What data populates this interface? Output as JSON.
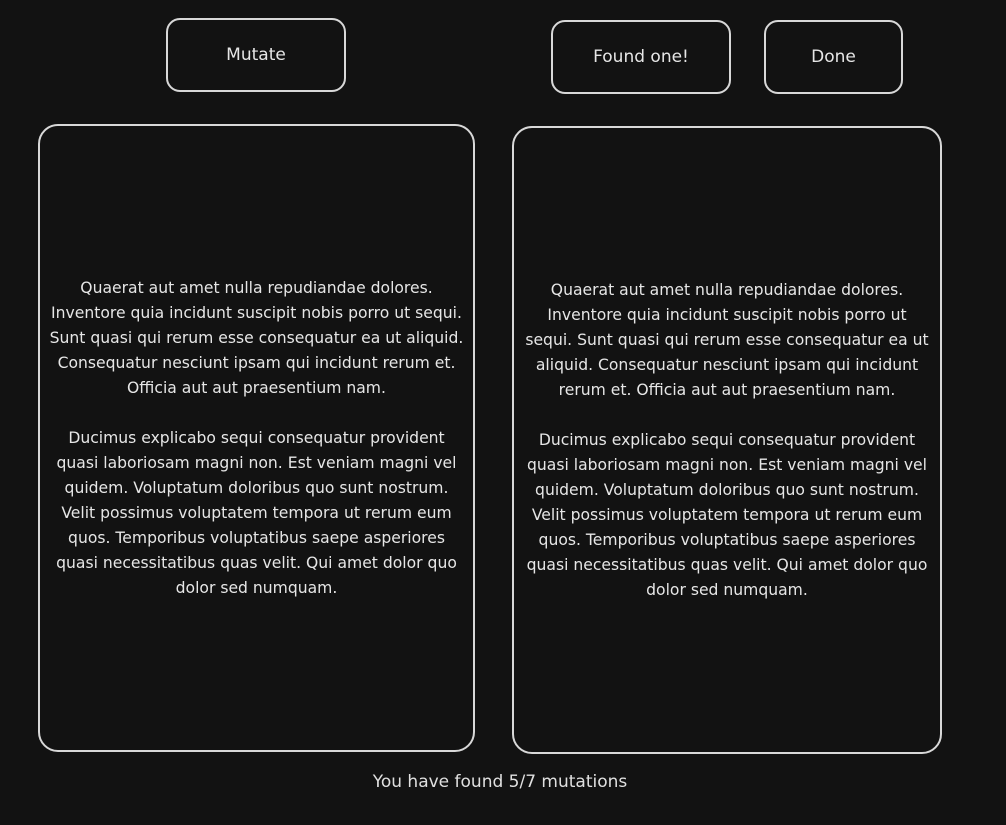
{
  "toolbar": {
    "mutate_label": "Mutate",
    "found_label": "Found one!",
    "done_label": "Done"
  },
  "panels": {
    "left": {
      "paragraphs": [
        "Quaerat aut amet nulla repudiandae dolores. Inventore quia incidunt suscipit nobis porro ut sequi. Sunt quasi qui rerum esse consequatur ea ut aliquid. Consequatur nesciunt ipsam qui incidunt rerum et. Officia aut aut praesentium nam.",
        "Ducimus explicabo sequi consequatur provident quasi laboriosam magni non. Est veniam magni vel quidem. Voluptatum doloribus quo sunt nostrum. Velit possimus voluptatem tempora ut rerum eum quos. Temporibus voluptatibus saepe asperiores quasi necessitatibus quas velit. Qui amet dolor quo dolor sed numquam."
      ]
    },
    "right": {
      "paragraphs": [
        "Quaerat aut amet nulla repudiandae dolores. Inventore quia incidunt suscipit nobis porro ut sequi. Sunt quasi qui rerum esse consequatur ea ut aliquid. Consequatur nesciunt ipsam qui incidunt rerum et. Officia aut aut praesentium nam.",
        "Ducimus explicabo sequi consequatur provident quasi laboriosam magni non. Est veniam magni vel quidem. Voluptatum doloribus quo sunt nostrum. Velit possimus voluptatem tempora ut rerum eum quos. Temporibus voluptatibus saepe asperiores quasi necessitatibus quas velit. Qui amet dolor quo dolor sed numquam."
      ]
    }
  },
  "status": {
    "text": "You have found 5/7 mutations"
  },
  "colors": {
    "background": "#121212",
    "border": "#d8d8d8",
    "text": "#e6e6e6"
  }
}
